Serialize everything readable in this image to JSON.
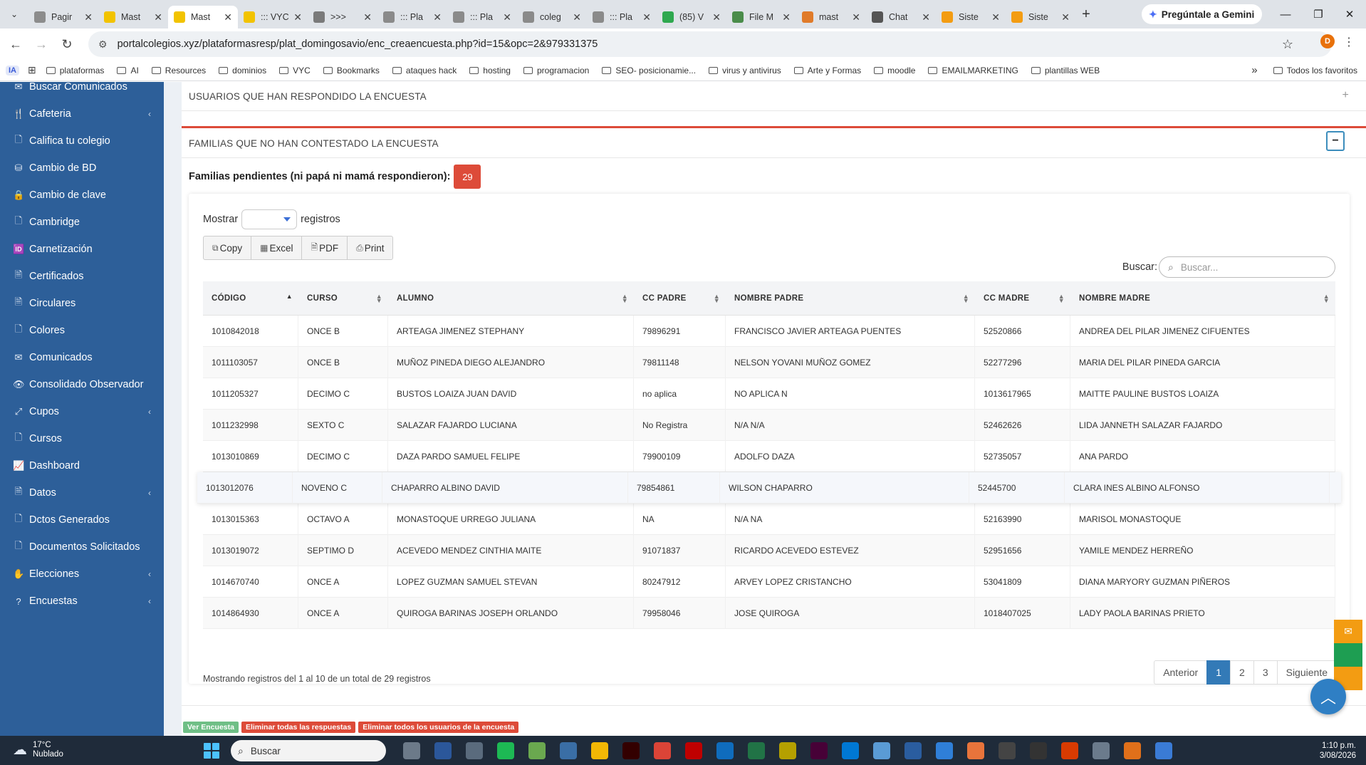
{
  "browser": {
    "tabs": [
      {
        "title": "Pagir",
        "color": "#8c8c8c"
      },
      {
        "title": "Mast",
        "color": "#f2c300"
      },
      {
        "title": "Mast",
        "color": "#f2c300",
        "active": true
      },
      {
        "title": "::: VYC",
        "color": "#f2c300"
      },
      {
        "title": ">>> ",
        "color": "#7a7a7a"
      },
      {
        "title": "::: Pla",
        "color": "#8a8a8a"
      },
      {
        "title": "::: Pla",
        "color": "#8a8a8a"
      },
      {
        "title": "coleg",
        "color": "#8a8a8a"
      },
      {
        "title": "::: Pla",
        "color": "#8a8a8a"
      },
      {
        "title": "(85) V",
        "color": "#2fa84f"
      },
      {
        "title": "File M",
        "color": "#4a8c4a"
      },
      {
        "title": "mast",
        "color": "#e07b2a"
      },
      {
        "title": "Chat",
        "color": "#555555"
      },
      {
        "title": "Siste",
        "color": "#f39c12"
      },
      {
        "title": "Siste",
        "color": "#f39c12"
      }
    ],
    "gemini_label": "Pregúntale a Gemini",
    "url": "portalcolegios.xyz/plataformasresp/plat_domingosavio/enc_creaencuesta.php?id=15&opc=2&979331375",
    "profile_initial": "D",
    "bookmarks_prefix": "IA",
    "bookmarks": [
      "plataformas",
      "AI",
      "Resources",
      "dominios",
      "VYC",
      "Bookmarks",
      "ataques hack",
      "hosting",
      "programacion",
      "SEO- posicionamie...",
      "virus y antivirus",
      "Arte y Formas",
      "moodle",
      "EMAILMARKETING",
      "plantillas WEB"
    ],
    "bookmarks_more": "»",
    "all_bookmarks": "Todos los favoritos"
  },
  "sidebar": {
    "items": [
      {
        "label": "Buscar Comunicados",
        "icon": "✉",
        "chev": false
      },
      {
        "label": "Cafeteria",
        "icon": "🍴",
        "chev": true
      },
      {
        "label": "Califica tu colegio",
        "icon": "🗋",
        "chev": false
      },
      {
        "label": "Cambio de BD",
        "icon": "⛁",
        "chev": false
      },
      {
        "label": "Cambio de clave",
        "icon": "🔒",
        "chev": false
      },
      {
        "label": "Cambridge",
        "icon": "🗋",
        "chev": false
      },
      {
        "label": "Carnetización",
        "icon": "🆔",
        "chev": false
      },
      {
        "label": "Certificados",
        "icon": "🗎",
        "chev": false
      },
      {
        "label": "Circulares",
        "icon": "🗎",
        "chev": false
      },
      {
        "label": "Colores",
        "icon": "🗋",
        "chev": false
      },
      {
        "label": "Comunicados",
        "icon": "✉",
        "chev": false
      },
      {
        "label": "Consolidado Observador",
        "icon": "👁",
        "chev": false
      },
      {
        "label": "Cupos",
        "icon": "⤢",
        "chev": true
      },
      {
        "label": "Cursos",
        "icon": "🗋",
        "chev": false
      },
      {
        "label": "Dashboard",
        "icon": "📈",
        "chev": false
      },
      {
        "label": "Datos",
        "icon": "🗎",
        "chev": true
      },
      {
        "label": "Dctos Generados",
        "icon": "🗋",
        "chev": false
      },
      {
        "label": "Documentos Solicitados",
        "icon": "🗋",
        "chev": false
      },
      {
        "label": "Elecciones",
        "icon": "✋",
        "chev": true
      },
      {
        "label": "Encuestas",
        "icon": "?",
        "chev": true
      }
    ]
  },
  "panels": {
    "responded_title": "USUARIOS QUE HAN RESPONDIDO LA ENCUESTA",
    "not_responded_title": "FAMILIAS QUE NO HAN CONTESTADO LA ENCUESTA",
    "plus": "+",
    "minus": "−"
  },
  "pending": {
    "label": "Familias pendientes (ni papá ni mamá respondieron):",
    "count": "29"
  },
  "table_controls": {
    "show_label": "Mostrar",
    "show_suffix": "registros",
    "buttons": [
      "Copy",
      "Excel",
      "PDF",
      "Print"
    ],
    "search_label": "Buscar:",
    "search_placeholder": "Buscar..."
  },
  "table": {
    "headers": [
      "CÓDIGO",
      "CURSO",
      "ALUMNO",
      "CC PADRE",
      "NOMBRE PADRE",
      "CC MADRE",
      "NOMBRE MADRE"
    ],
    "rows": [
      [
        "1010842018",
        "ONCE B",
        "ARTEAGA JIMENEZ STEPHANY",
        "79896291",
        "FRANCISCO JAVIER ARTEAGA PUENTES",
        "52520866",
        "ANDREA DEL PILAR JIMENEZ CIFUENTES"
      ],
      [
        "1011103057",
        "ONCE B",
        "MUÑOZ PINEDA DIEGO ALEJANDRO",
        "79811148",
        "NELSON YOVANI MUÑOZ GOMEZ",
        "52277296",
        "MARIA DEL PILAR PINEDA GARCIA"
      ],
      [
        "1011205327",
        "DECIMO C",
        "BUSTOS LOAIZA JUAN DAVID",
        "no aplica",
        "NO APLICA N",
        "1013617965",
        "MAITTE PAULINE BUSTOS LOAIZA"
      ],
      [
        "1011232998",
        "SEXTO C",
        "SALAZAR FAJARDO LUCIANA",
        "No Registra",
        "N/A N/A",
        "52462626",
        "LIDA JANNETH SALAZAR FAJARDO"
      ],
      [
        "1013010869",
        "DECIMO C",
        "DAZA PARDO SAMUEL FELIPE",
        "79900109",
        "ADOLFO DAZA",
        "52735057",
        "ANA PARDO"
      ],
      [
        "1013012076",
        "NOVENO C",
        "CHAPARRO ALBINO DAVID",
        "79854861",
        "WILSON CHAPARRO",
        "52445700",
        "CLARA INES ALBINO ALFONSO"
      ],
      [
        "1013015363",
        "OCTAVO A",
        "MONASTOQUE URREGO JULIANA",
        "NA",
        "N/A NA",
        "52163990",
        "MARISOL MONASTOQUE"
      ],
      [
        "1013019072",
        "SEPTIMO D",
        "ACEVEDO MENDEZ CINTHIA MAITE",
        "91071837",
        "RICARDO ACEVEDO ESTEVEZ",
        "52951656",
        "YAMILE MENDEZ HERREÑO"
      ],
      [
        "1014670740",
        "ONCE A",
        "LOPEZ GUZMAN SAMUEL STEVAN",
        "80247912",
        "ARVEY LOPEZ CRISTANCHO",
        "53041809",
        "DIANA MARYORY GUZMAN PIÑEROS"
      ],
      [
        "1014864930",
        "ONCE A",
        "QUIROGA BARINAS JOSEPH ORLANDO",
        "79958046",
        "JOSE QUIROGA",
        "1018407025",
        "LADY PAOLA BARINAS PRIETO"
      ]
    ],
    "info": "Mostrando registros del 1 al 10 de un total de 29 registros",
    "pagination": [
      "Anterior",
      "1",
      "2",
      "3",
      "Siguiente"
    ],
    "active_page": "1"
  },
  "footer_buttons": [
    "Ver Encuesta",
    "Eliminar todas las respuestas",
    "Eliminar todos los usuarios de la encuesta"
  ],
  "taskbar": {
    "temp": "17°C",
    "weather": "Nublado",
    "search": "Buscar",
    "time": "1:10 p.m.",
    "date": "3/08/2026"
  },
  "colors": {
    "sidebar": "#2d5f99",
    "danger": "#dd4b39",
    "primary": "#337ab7",
    "success": "#6fbf86"
  }
}
